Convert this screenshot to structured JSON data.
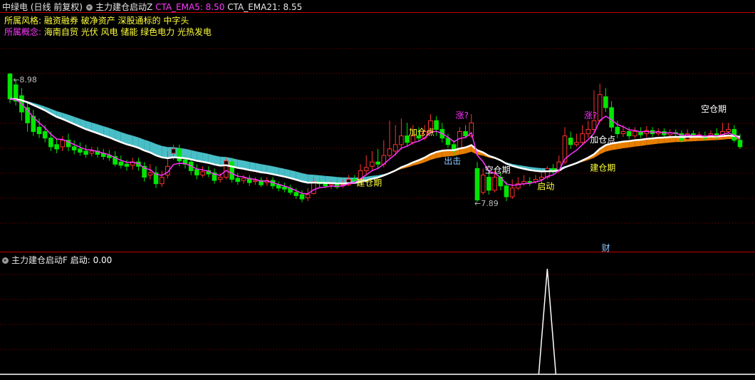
{
  "header": {
    "stock_label": "中绿电 (日线 前复权)",
    "indicator_name": "主力建仓启动Z",
    "ema5_text": "CTA_EMA5: 8.50",
    "ema21_text": "CTA_EMA21: 8.55"
  },
  "info": {
    "style_label": "所属风格:",
    "style_value": "融资融券 破净资产 深股通标的 中字头",
    "concept_label": "所属概念:",
    "concept_value": "海南自贸 光伏 风电 储能 绿色电力 光热发电"
  },
  "sub_panel": {
    "indicator_name": "主力建仓启动F",
    "value_text": "启动: 0.00"
  },
  "colors": {
    "up": "#ff3232",
    "down": "#00e600",
    "fill_cyan": "#4cc8d2",
    "ema_magenta": "#ff32ff",
    "ema_yellow": "#ffff00",
    "grid": "#8c0000",
    "label_yellow": "#ffff3c",
    "label_magenta": "#ff32ff",
    "label_blue": "#8cc8ff"
  },
  "chart_data": {
    "type": "candlestick",
    "price_axis": {
      "min": 7.5,
      "max": 9.35,
      "gridlines": true
    },
    "high_low_marks": {
      "high": "8.98",
      "low": "7.89"
    },
    "candles": [
      [
        9.05,
        8.82,
        9.06,
        8.78
      ],
      [
        8.95,
        8.8,
        9.0,
        8.76
      ],
      [
        8.85,
        8.7,
        8.92,
        8.62
      ],
      [
        8.74,
        8.6,
        8.8,
        8.52
      ],
      [
        8.66,
        8.52,
        8.72,
        8.48
      ],
      [
        8.56,
        8.5,
        8.64,
        8.46
      ],
      [
        8.52,
        8.46,
        8.58,
        8.42
      ],
      [
        8.46,
        8.38,
        8.52,
        8.34
      ],
      [
        8.4,
        8.36,
        8.46,
        8.32
      ],
      [
        8.38,
        8.44,
        8.48,
        8.34
      ],
      [
        8.44,
        8.38,
        8.5,
        8.34
      ],
      [
        8.38,
        8.35,
        8.44,
        8.31
      ],
      [
        8.36,
        8.33,
        8.42,
        8.3
      ],
      [
        8.34,
        8.31,
        8.4,
        8.28
      ],
      [
        8.32,
        8.34,
        8.38,
        8.29
      ],
      [
        8.34,
        8.31,
        8.38,
        8.28
      ],
      [
        8.32,
        8.29,
        8.36,
        8.26
      ],
      [
        8.3,
        8.28,
        8.35,
        8.25
      ],
      [
        8.29,
        8.22,
        8.34,
        8.2
      ],
      [
        8.24,
        8.21,
        8.3,
        8.18
      ],
      [
        8.22,
        8.2,
        8.26,
        8.16
      ],
      [
        8.21,
        8.24,
        8.28,
        8.17
      ],
      [
        8.24,
        8.2,
        8.28,
        8.16
      ],
      [
        8.2,
        8.1,
        8.24,
        8.06
      ],
      [
        8.12,
        8.14,
        8.22,
        8.08
      ],
      [
        8.14,
        8.04,
        8.2,
        8.0
      ],
      [
        8.04,
        8.1,
        8.16,
        8.01
      ],
      [
        8.12,
        8.2,
        8.34,
        8.09
      ],
      [
        8.32,
        8.36,
        8.4,
        8.26
      ],
      [
        8.36,
        8.25,
        8.4,
        8.2
      ],
      [
        8.26,
        8.22,
        8.3,
        8.18
      ],
      [
        8.24,
        8.16,
        8.28,
        8.12
      ],
      [
        8.17,
        8.12,
        8.22,
        8.08
      ],
      [
        8.12,
        8.15,
        8.2,
        8.1
      ],
      [
        8.16,
        8.13,
        8.2,
        8.1
      ],
      [
        8.14,
        8.07,
        8.18,
        8.04
      ],
      [
        8.08,
        8.1,
        8.14,
        8.05
      ],
      [
        8.1,
        8.25,
        8.28,
        8.08
      ],
      [
        8.24,
        8.08,
        8.28,
        8.05
      ],
      [
        8.09,
        8.06,
        8.14,
        8.03
      ],
      [
        8.07,
        8.09,
        8.12,
        8.04
      ],
      [
        8.09,
        8.05,
        8.12,
        8.02
      ],
      [
        8.06,
        8.07,
        8.1,
        8.03
      ],
      [
        8.07,
        8.03,
        8.1,
        8.01
      ],
      [
        8.05,
        8.07,
        8.1,
        8.02
      ],
      [
        8.07,
        8.02,
        8.1,
        7.99
      ],
      [
        8.03,
        8.0,
        8.06,
        7.97
      ],
      [
        8.01,
        7.99,
        8.05,
        7.96
      ],
      [
        8.0,
        7.96,
        8.03,
        7.94
      ],
      [
        7.96,
        7.93,
        8.0,
        7.9
      ],
      [
        7.94,
        7.9,
        7.98,
        7.87
      ],
      [
        7.91,
        7.94,
        8.0,
        7.88
      ],
      [
        7.95,
        8.06,
        8.1,
        7.94
      ],
      [
        8.06,
        8.04,
        8.09,
        8.01
      ],
      [
        8.04,
        8.02,
        8.07,
        8.0
      ],
      [
        8.03,
        8.04,
        8.07,
        7.99
      ],
      [
        8.04,
        8.01,
        8.07,
        7.99
      ],
      [
        8.02,
        8.03,
        8.08,
        8.0
      ],
      [
        8.03,
        8.08,
        8.12,
        8.02
      ],
      [
        8.08,
        8.07,
        8.12,
        8.04
      ],
      [
        8.08,
        8.16,
        8.22,
        8.07
      ],
      [
        8.16,
        8.19,
        8.3,
        8.12
      ],
      [
        8.2,
        8.24,
        8.34,
        8.16
      ],
      [
        8.24,
        8.22,
        8.36,
        8.18
      ],
      [
        8.22,
        8.3,
        8.44,
        8.19
      ],
      [
        8.3,
        8.36,
        8.62,
        8.28
      ],
      [
        8.34,
        8.4,
        8.58,
        8.3
      ],
      [
        8.4,
        8.48,
        8.64,
        8.35
      ],
      [
        8.48,
        8.42,
        8.6,
        8.38
      ],
      [
        8.42,
        8.48,
        8.58,
        8.4
      ],
      [
        8.48,
        8.46,
        8.56,
        8.43
      ],
      [
        8.46,
        8.52,
        8.58,
        8.44
      ],
      [
        8.52,
        8.62,
        8.68,
        8.5
      ],
      [
        8.62,
        8.54,
        8.66,
        8.48
      ],
      [
        8.54,
        8.46,
        8.6,
        8.42
      ],
      [
        8.46,
        8.4,
        8.5,
        8.37
      ],
      [
        8.4,
        8.34,
        8.44,
        8.3
      ],
      [
        8.36,
        8.52,
        8.56,
        8.34
      ],
      [
        8.52,
        8.48,
        8.58,
        8.46
      ],
      [
        8.48,
        8.6,
        8.68,
        8.46
      ],
      [
        8.18,
        7.89,
        8.24,
        7.87
      ],
      [
        7.96,
        8.12,
        8.18,
        7.94
      ],
      [
        8.1,
        7.98,
        8.14,
        7.94
      ],
      [
        7.98,
        8.1,
        8.16,
        7.96
      ],
      [
        8.1,
        8.02,
        8.14,
        7.98
      ],
      [
        8.02,
        7.92,
        8.06,
        7.88
      ],
      [
        7.92,
        8.0,
        8.08,
        7.9
      ],
      [
        8.0,
        8.04,
        8.1,
        7.98
      ],
      [
        8.04,
        8.06,
        8.12,
        8.02
      ],
      [
        8.06,
        8.05,
        8.1,
        8.02
      ],
      [
        8.06,
        8.08,
        8.12,
        8.04
      ],
      [
        8.08,
        8.1,
        8.14,
        8.06
      ],
      [
        8.1,
        8.18,
        8.2,
        8.08
      ],
      [
        8.18,
        8.15,
        8.22,
        8.13
      ],
      [
        8.16,
        8.24,
        8.3,
        8.14
      ],
      [
        8.24,
        8.48,
        8.56,
        8.22
      ],
      [
        8.46,
        8.4,
        8.52,
        8.36
      ],
      [
        8.4,
        8.42,
        8.5,
        8.38
      ],
      [
        8.42,
        8.5,
        8.58,
        8.4
      ],
      [
        8.5,
        8.54,
        8.62,
        8.46
      ],
      [
        8.54,
        8.62,
        8.9,
        8.52
      ],
      [
        8.62,
        8.86,
        8.96,
        8.6
      ],
      [
        8.84,
        8.74,
        8.92,
        8.7
      ],
      [
        8.74,
        8.56,
        8.8,
        8.52
      ],
      [
        8.56,
        8.5,
        8.62,
        8.46
      ],
      [
        8.5,
        8.52,
        8.58,
        8.47
      ],
      [
        8.52,
        8.48,
        8.56,
        8.45
      ],
      [
        8.48,
        8.52,
        8.56,
        8.46
      ],
      [
        8.52,
        8.49,
        8.56,
        8.46
      ],
      [
        8.5,
        8.53,
        8.57,
        8.47
      ],
      [
        8.53,
        8.5,
        8.56,
        8.47
      ],
      [
        8.5,
        8.52,
        8.55,
        8.48
      ],
      [
        8.52,
        8.49,
        8.55,
        8.46
      ],
      [
        8.49,
        8.51,
        8.54,
        8.47
      ],
      [
        8.51,
        8.5,
        8.54,
        8.48
      ],
      [
        8.5,
        8.44,
        8.53,
        8.42
      ],
      [
        8.45,
        8.5,
        8.54,
        8.44
      ],
      [
        8.5,
        8.47,
        8.53,
        8.45
      ],
      [
        8.47,
        8.49,
        8.52,
        8.45
      ],
      [
        8.48,
        8.46,
        8.52,
        8.44
      ],
      [
        8.48,
        8.5,
        8.53,
        8.46
      ],
      [
        8.5,
        8.47,
        8.55,
        8.45
      ],
      [
        8.47,
        8.52,
        8.6,
        8.46
      ],
      [
        8.52,
        8.54,
        8.6,
        8.5
      ],
      [
        8.54,
        8.44,
        8.58,
        8.42
      ],
      [
        8.44,
        8.38,
        8.5,
        8.36
      ]
    ],
    "annotations": [
      {
        "text": "加仓点",
        "color": "yellow",
        "index": 70
      },
      {
        "text": "出击",
        "color": "blue",
        "index": 76
      },
      {
        "text": "涨?",
        "color": "magenta",
        "index": 78
      },
      {
        "text": "建仓期",
        "color": "yellow",
        "index": 61
      },
      {
        "text": "空仓期",
        "color": "white",
        "index": 83
      },
      {
        "text": "启动",
        "color": "yellow",
        "index": 92
      },
      {
        "text": "涨?",
        "color": "magenta",
        "index": 100
      },
      {
        "text": "加仓点",
        "color": "white",
        "index": 101
      },
      {
        "text": "建仓期",
        "color": "yellow",
        "index": 101
      },
      {
        "text": "空仓期",
        "color": "white",
        "index": 120
      },
      {
        "text": "财",
        "color": "blue",
        "index": 103
      }
    ],
    "sub_signal": {
      "name": "启动",
      "current": 0.0,
      "spike_index": 92,
      "spike_value": 1
    }
  }
}
